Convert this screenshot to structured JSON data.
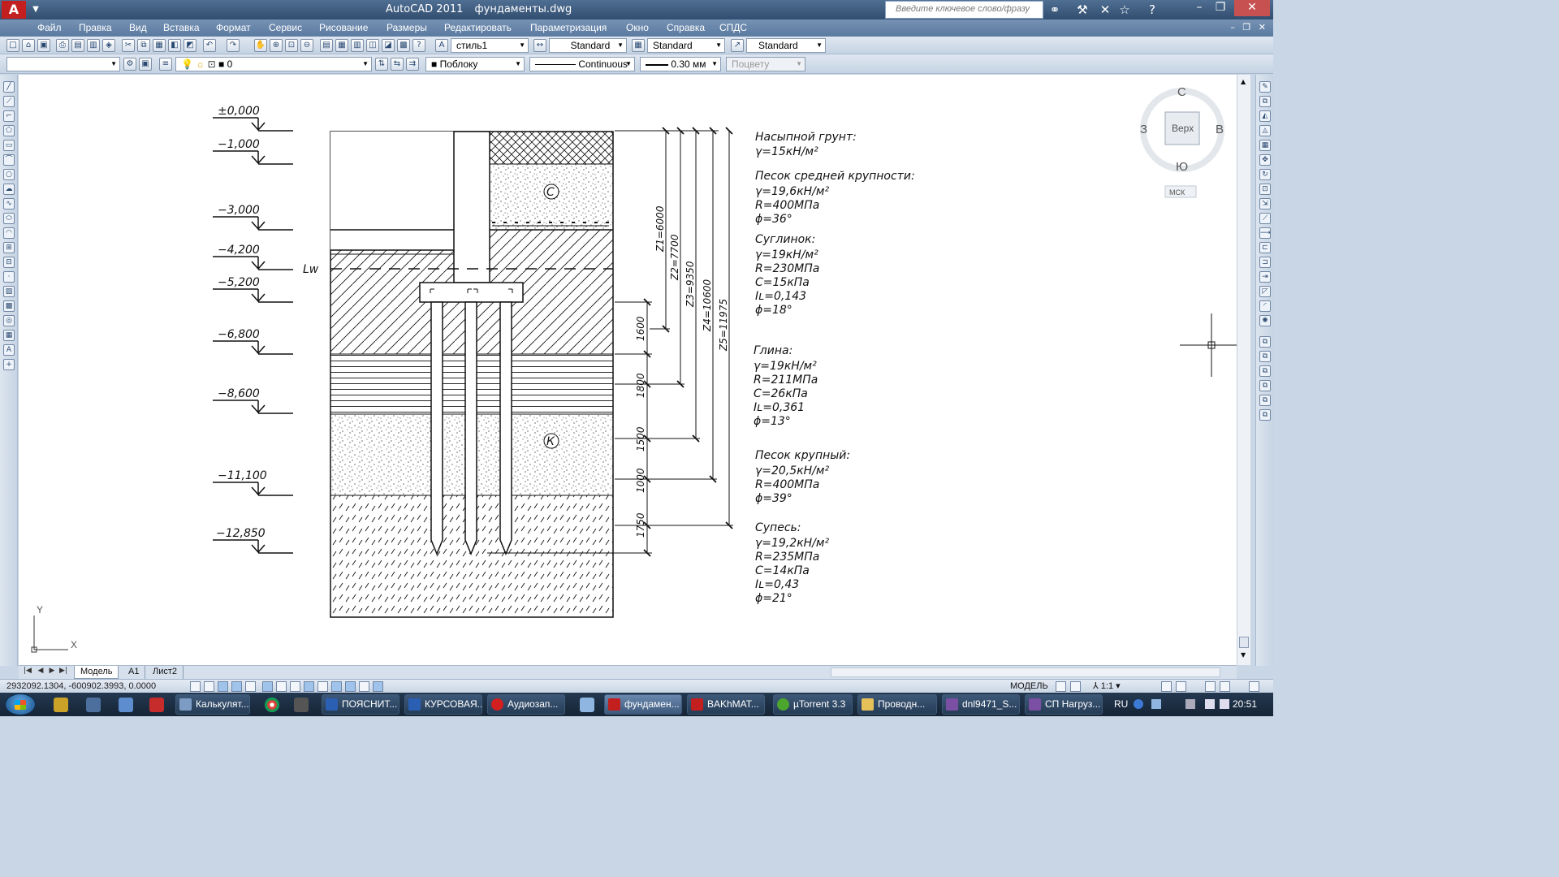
{
  "colors": {
    "canvas": "#ffffff",
    "titlebar": "#3b5a80",
    "accent": "#c41f1f",
    "taskbar": "#1c2f44"
  },
  "titlebar": {
    "app_name": "AutoCAD 2011",
    "file_name": "фундаменты.dwg",
    "search_placeholder": "Введите ключевое слово/фразу",
    "icons": [
      "binoculars-icon",
      "tools-icon",
      "wrench-icon",
      "star-icon",
      "help-icon"
    ]
  },
  "menu": [
    "Файл",
    "Правка",
    "Вид",
    "Вставка",
    "Формат",
    "Сервис",
    "Рисование",
    "Размеры",
    "Редактировать",
    "Параметризация",
    "Окно",
    "Справка",
    "СПДС"
  ],
  "toolbar1": {
    "text_style": "стиль1",
    "dim_style": "Standard",
    "table_style": "Standard",
    "multileader_style": "Standard"
  },
  "toolbar2": {
    "layer_state": "",
    "layer": "0",
    "color": "■ Поблоку",
    "linetype": "Continuous",
    "lineweight": "0.30 мм",
    "plot_style": "Поцвету"
  },
  "viewcube": {
    "north": "С",
    "south": "Ю",
    "west": "З",
    "east": "В",
    "face": "Верх",
    "ucs": "МСК"
  },
  "drawing": {
    "levels": [
      "±0,000",
      "−1,000",
      "−3,000",
      "−4,200",
      "−5,200",
      "−6,800",
      "−8,600",
      "−11,100",
      "−12,850"
    ],
    "water_label": "Lw",
    "layer_markers": [
      "С",
      "К"
    ],
    "dims_right": [
      "1600",
      "1800",
      "1500",
      "1000",
      "1750"
    ],
    "dims_z": [
      "Z1=6000",
      "Z2=7700",
      "Z3=9350",
      "Z4=10600",
      "Z5=11975"
    ],
    "ucs_x": "X",
    "ucs_y": "Y",
    "soils": [
      {
        "name": "Насыпной грунт:",
        "props": [
          "γ=15кН/м²"
        ]
      },
      {
        "name": "Песок средней крупности:",
        "props": [
          "γ=19,6кН/м²",
          "R=400МПа",
          "ϕ=36°"
        ]
      },
      {
        "name": "Суглинок:",
        "props": [
          "γ=19кН/м²",
          "R=230МПа",
          "C=15кПа",
          "Iʟ=0,143",
          "ϕ=18°"
        ]
      },
      {
        "name": "Глина:",
        "props": [
          "γ=19кН/м²",
          "R=211МПа",
          "C=26кПа",
          "Iʟ=0,361",
          "ϕ=13°"
        ]
      },
      {
        "name": "Песок крупный:",
        "props": [
          "γ=20,5кН/м²",
          "R=400МПа",
          "ϕ=39°"
        ]
      },
      {
        "name": "Супесь:",
        "props": [
          "γ=19,2кН/м²",
          "R=235МПа",
          "C=14кПа",
          "Iʟ=0,43",
          "ϕ=21°"
        ]
      }
    ]
  },
  "tabs": [
    "Модель",
    "А1",
    "Лист2"
  ],
  "statusbar": {
    "coords": "2932092.1304, -600902.3993, 0.0000",
    "model": "МОДЕЛЬ",
    "scale": "1:1"
  },
  "taskbar": {
    "tasks": [
      "Калькулят...",
      "ПОЯСНИТ...",
      "КУРСОВАЯ...",
      "Аудиозап...",
      "фундамен...",
      "BAKhMAT...",
      "µTorrent 3.3",
      "Проводн...",
      "dnl9471_S...",
      "СП Нагруз..."
    ],
    "lang": "RU",
    "time": "20:51"
  }
}
